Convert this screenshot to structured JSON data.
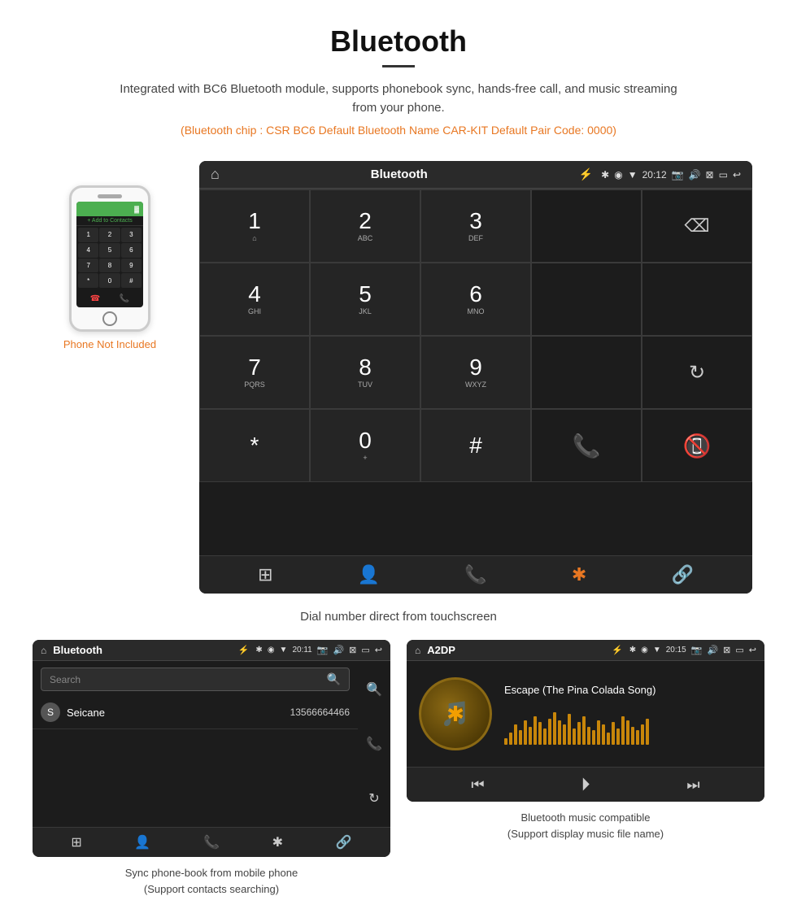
{
  "page": {
    "title": "Bluetooth",
    "description": "Integrated with BC6 Bluetooth module, supports phonebook sync, hands-free call, and music streaming from your phone.",
    "specs_line": "(Bluetooth chip : CSR BC6   Default Bluetooth Name CAR-KIT    Default Pair Code: 0000)",
    "phone_not_included": "Phone Not Included",
    "dial_caption": "Dial number direct from touchscreen"
  },
  "dial_screen": {
    "header_title": "Bluetooth",
    "header_usb": "⚡",
    "time": "20:12",
    "keys": [
      {
        "num": "1",
        "letters": "⌂"
      },
      {
        "num": "2",
        "letters": "ABC"
      },
      {
        "num": "3",
        "letters": "DEF"
      },
      {
        "num": "",
        "letters": ""
      },
      {
        "num": "⌫",
        "letters": ""
      },
      {
        "num": "4",
        "letters": "GHI"
      },
      {
        "num": "5",
        "letters": "JKL"
      },
      {
        "num": "6",
        "letters": "MNO"
      },
      {
        "num": "",
        "letters": ""
      },
      {
        "num": "",
        "letters": ""
      },
      {
        "num": "7",
        "letters": "PQRS"
      },
      {
        "num": "8",
        "letters": "TUV"
      },
      {
        "num": "9",
        "letters": "WXYZ"
      },
      {
        "num": "",
        "letters": ""
      },
      {
        "num": "↻",
        "letters": ""
      },
      {
        "num": "*",
        "letters": ""
      },
      {
        "num": "0",
        "letters": "+"
      },
      {
        "num": "#",
        "letters": ""
      },
      {
        "num": "📞",
        "letters": ""
      },
      {
        "num": "📵",
        "letters": ""
      }
    ],
    "bottom_nav": [
      "⊞",
      "👤",
      "📞",
      "✱",
      "🔗"
    ]
  },
  "phonebook_screen": {
    "header_title": "Bluetooth",
    "header_usb": "⚡",
    "time": "20:11",
    "search_placeholder": "Search",
    "contacts": [
      {
        "initial": "S",
        "name": "Seicane",
        "number": "13566664466"
      }
    ],
    "bottom_nav": [
      "⊞",
      "👤",
      "📞",
      "✱",
      "🔗"
    ],
    "caption_line1": "Sync phone-book from mobile phone",
    "caption_line2": "(Support contacts searching)"
  },
  "music_screen": {
    "header_title": "A2DP",
    "header_usb": "⚡",
    "time": "20:15",
    "song_title": "Escape (The Pina Colada Song)",
    "visualizer_bars": [
      8,
      15,
      25,
      18,
      30,
      22,
      35,
      28,
      20,
      32,
      40,
      30,
      25,
      38,
      20,
      28,
      35,
      22,
      18,
      30,
      25,
      15,
      28,
      20,
      35,
      30,
      22,
      18,
      25,
      32
    ],
    "controls": [
      "⏮",
      "⏭",
      "⏵"
    ],
    "caption_line1": "Bluetooth music compatible",
    "caption_line2": "(Support display music file name)"
  },
  "icons": {
    "home": "⌂",
    "back": "↩",
    "bluetooth": "✱",
    "camera": "📷",
    "volume": "🔊",
    "close": "✕",
    "window": "▢",
    "signal": "▼",
    "gps": "◉",
    "battery": "🔋"
  }
}
